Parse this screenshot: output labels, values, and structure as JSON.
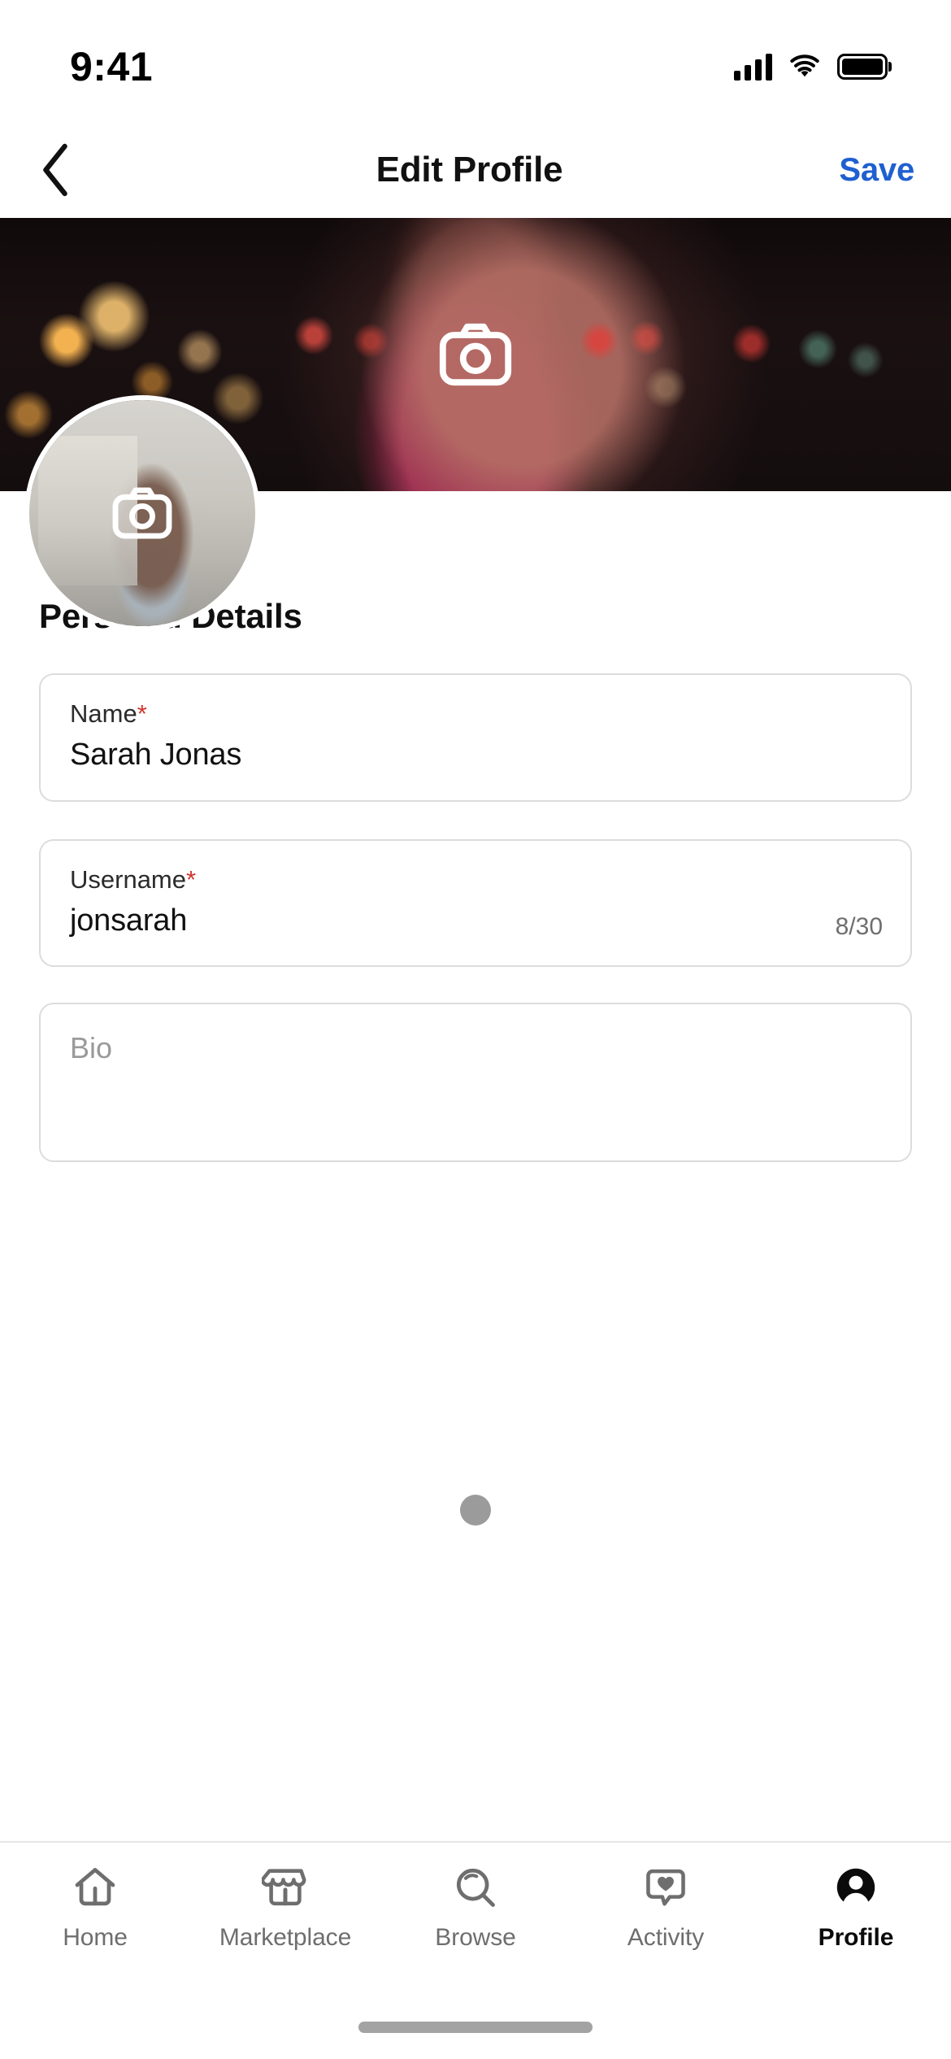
{
  "status_bar": {
    "time": "9:41",
    "signal_icon": "cellular-signal-icon",
    "wifi_icon": "wifi-icon",
    "battery_icon": "battery-full-icon"
  },
  "nav": {
    "back_icon": "chevron-left-icon",
    "title": "Edit Profile",
    "save_label": "Save",
    "save_color": "#1f5fd0"
  },
  "cover": {
    "change_cover_icon": "camera-icon",
    "change_avatar_icon": "camera-icon",
    "avatar_name": "avatar"
  },
  "form": {
    "section_title": "Personal Details",
    "fields": [
      {
        "name": "name",
        "label": "Name",
        "required_marker": "*",
        "value": "Sarah Jonas",
        "counter": ""
      },
      {
        "name": "username",
        "label": "Username",
        "required_marker": "*",
        "value": "jonsarah",
        "counter": "8/30"
      }
    ],
    "bio": {
      "name": "bio",
      "placeholder": "Bio",
      "value": ""
    },
    "required_color": "#d0342c"
  },
  "tab_bar": {
    "items": [
      {
        "label": "Home",
        "icon": "home-icon",
        "active": false
      },
      {
        "label": "Marketplace",
        "icon": "storefront-icon",
        "active": false
      },
      {
        "label": "Browse",
        "icon": "search-icon",
        "active": false
      },
      {
        "label": "Activity",
        "icon": "heart-chat-icon",
        "active": false
      },
      {
        "label": "Profile",
        "icon": "person-icon",
        "active": true
      }
    ]
  }
}
